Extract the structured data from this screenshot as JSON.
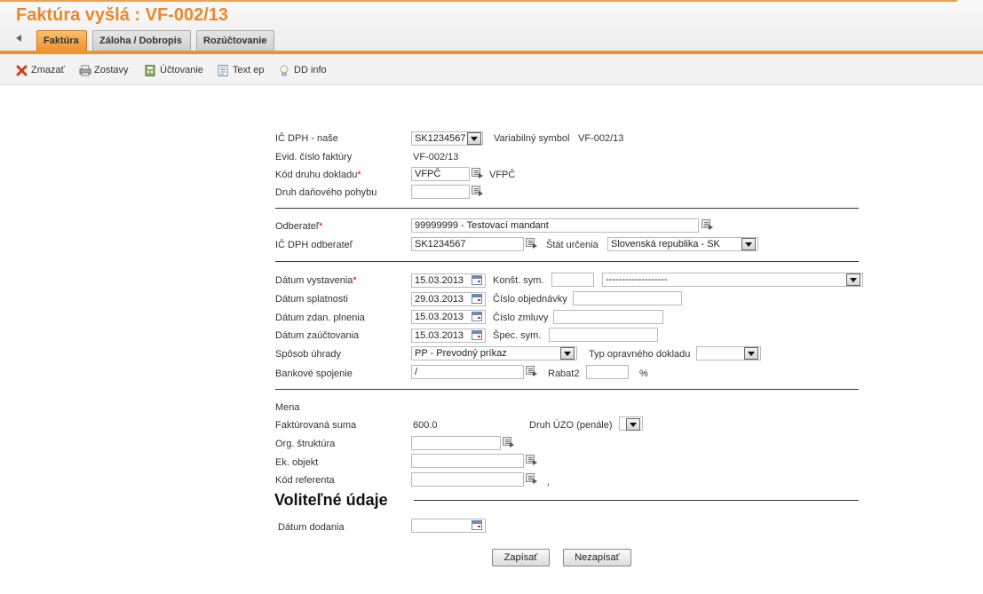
{
  "header": {
    "title": "Faktúra vyšlá :  VF-002/13",
    "tabs": [
      {
        "label": "Faktúra",
        "active": true
      },
      {
        "label": "Záloha / Dobropis",
        "active": false
      },
      {
        "label": "Rozúčtovanie",
        "active": false
      }
    ]
  },
  "toolbar": {
    "items": [
      {
        "label": "Zmazať",
        "icon": "delete-x-icon"
      },
      {
        "label": "Zostavy",
        "icon": "printer-icon"
      },
      {
        "label": "Účtovanie",
        "icon": "calculator-icon"
      },
      {
        "label": "Text ep",
        "icon": "document-icon"
      },
      {
        "label": "DD info",
        "icon": "lightbulb-icon"
      }
    ]
  },
  "form": {
    "ic_dph_nase": {
      "label": "IČ DPH - naše",
      "value": "SK1234567"
    },
    "variabilny_symbol": {
      "label": "Variabilný symbol",
      "value": "VF-002/13"
    },
    "evid_cislo": {
      "label": "Evid. číslo faktúry",
      "value": "VF-002/13"
    },
    "kod_druhu": {
      "label": "Kód druhu dokladu",
      "value": "VFPČ",
      "extra": "VFPČ"
    },
    "druh_danoveho": {
      "label": "Druh daňového pohybu",
      "value": ""
    },
    "odberatel": {
      "label": "Odberateľ",
      "value": "99999999 - Testovací mandant"
    },
    "ic_dph_odberatel": {
      "label": "IČ DPH odberateľ",
      "value": "SK1234567"
    },
    "stat_urcenia": {
      "label": "Štát určenia",
      "value": "Slovenská republika - SK"
    },
    "datum_vystavenia": {
      "label": "Dátum vystavenia",
      "value": "15.03.2013"
    },
    "konst_sym": {
      "label": "Konšt. sym.",
      "value": "",
      "select_value": "-------------------"
    },
    "datum_splatnosti": {
      "label": "Dátum splatnosti",
      "value": "29.03.2013"
    },
    "cislo_objednavky": {
      "label": "Číslo objednávky",
      "value": ""
    },
    "datum_zdan": {
      "label": "Dátum zdan. plnenia",
      "value": "15.03.2013"
    },
    "cislo_zmluvy": {
      "label": "Číslo zmluvy",
      "value": ""
    },
    "datum_zauct": {
      "label": "Dátum zaúčtovania",
      "value": "15.03.2013"
    },
    "spec_sym": {
      "label": "Špec. sym.",
      "value": ""
    },
    "sposob_uhrady": {
      "label": "Spôsob úhrady",
      "value": "PP - Prevodný príkaz"
    },
    "typ_opravneho": {
      "label": "Typ opravného dokladu",
      "value": ""
    },
    "bankove_spojenie": {
      "label": "Bankové spojenie",
      "value": "/"
    },
    "rabat2": {
      "label": "Rabat2",
      "value": "",
      "unit": "%"
    },
    "mena": {
      "label": "Mena"
    },
    "fakturovana_suma": {
      "label": "Faktúrovaná suma",
      "value": "600.0"
    },
    "druh_uzo": {
      "label": "Druh ÚZO (penále)",
      "value": ""
    },
    "org_struktura": {
      "label": "Org. štruktúra",
      "value": ""
    },
    "ek_objekt": {
      "label": "Ek. objekt",
      "value": ""
    },
    "kod_referenta": {
      "label": "Kód referenta",
      "value": "",
      "suffix": ","
    },
    "volitelne_udaje": "Voliteľné údaje",
    "datum_dodania": {
      "label": "Dátum dodania",
      "value": ""
    }
  },
  "buttons": {
    "save": "Zapísať",
    "cancel": "Nezapísať"
  },
  "colors": {
    "accent": "#f0922e",
    "title": "#e8892a",
    "required": "#dd0000"
  }
}
